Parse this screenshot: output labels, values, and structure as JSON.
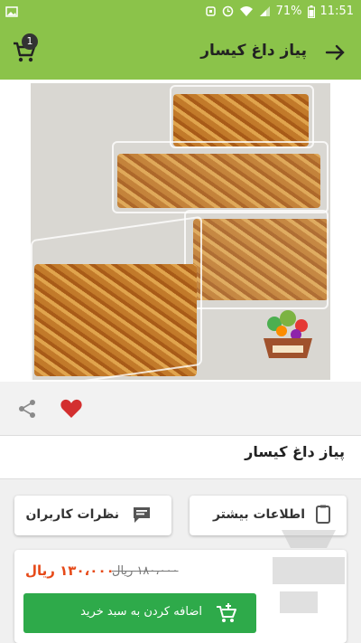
{
  "status_bar": {
    "battery_percent": "71%",
    "time": "11:51",
    "left_icon": "image-icon",
    "icons": [
      "alarm-icon",
      "clock-icon",
      "wifi-icon",
      "signal-icon",
      "battery-icon"
    ]
  },
  "app_bar": {
    "title": "پیاز داغ کیسار",
    "back_icon": "arrow-right-icon",
    "cart_icon": "cart-icon",
    "cart_count": "1",
    "color": "#8bc34a"
  },
  "product": {
    "name": "پیاز داغ کیسار",
    "share_icon": "share-icon",
    "favorite_icon": "heart-icon",
    "favorite_color": "#d32f2f"
  },
  "buttons": {
    "more_info": "اطلاعات بیشتر",
    "more_info_icon": "document-icon",
    "reviews": "نظرات کاربران",
    "reviews_icon": "comment-icon"
  },
  "pricing": {
    "price": "۱۳۰،۰۰۰ ریال",
    "old_price": "۱۸۰،۰۰۰ ریال",
    "price_color": "#e64a19",
    "add_to_cart": "اضافه کردن به سبد خرید",
    "add_to_cart_icon": "cart-plus-icon",
    "add_color": "#2eaa4a"
  }
}
